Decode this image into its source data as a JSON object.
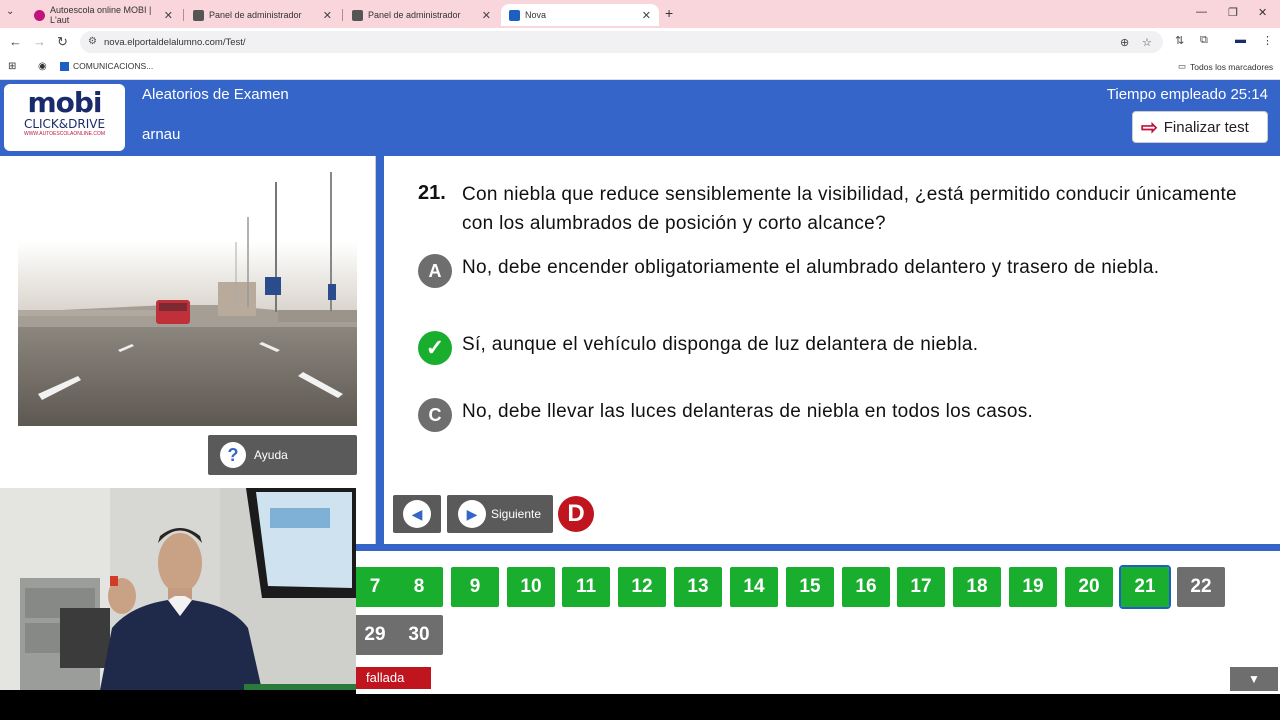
{
  "browser": {
    "tabs": [
      {
        "title": "Autoescola online MOBI | L'aut",
        "color": "#c0147a"
      },
      {
        "title": "Panel de administrador",
        "color": "#444"
      },
      {
        "title": "Panel de administrador",
        "color": "#444"
      },
      {
        "title": "Nova",
        "color": "#1e5fc4"
      }
    ],
    "new_tab": "+",
    "url": "nova.elportaldelalumno.com/Test/",
    "bookmarks": [
      {
        "label": "COMUNICACIONS..."
      }
    ],
    "all_bookmarks": "Todos los marcadores"
  },
  "header": {
    "logo_main": "mobi",
    "logo_sub": "CLICK&DRIVE",
    "logo_url": "WWW.AUTOESCOLAONLINE.COM",
    "exam_title": "Aleatorios de Examen",
    "user": "arnau",
    "timer": "Tiempo empleado 25:14",
    "finish_label": "Finalizar test"
  },
  "left": {
    "help_label": "Ayuda"
  },
  "question": {
    "number": "21.",
    "text": "Con niebla que reduce sensiblemente la visibilidad, ¿está permitido conducir únicamente con los alumbrados de posición y corto alcance?",
    "answers": [
      {
        "letter": "A",
        "text": "No, debe encender obligatoriamente el alumbrado delantero y trasero de niebla.",
        "correct": false
      },
      {
        "letter": "✓",
        "text": "Sí, aunque el vehículo disponga de luz delantera de niebla.",
        "correct": true
      },
      {
        "letter": "C",
        "text": "No, debe llevar las luces delanteras de niebla en todos los casos.",
        "correct": false
      }
    ],
    "next_label": "Siguiente",
    "d_label": "D"
  },
  "grid": {
    "row1": [
      {
        "n": "7",
        "state": "answered"
      },
      {
        "n": "8",
        "state": "answered"
      },
      {
        "n": "9",
        "state": "answered"
      },
      {
        "n": "10",
        "state": "answered"
      },
      {
        "n": "11",
        "state": "answered"
      },
      {
        "n": "12",
        "state": "answered"
      },
      {
        "n": "13",
        "state": "answered"
      },
      {
        "n": "14",
        "state": "answered"
      },
      {
        "n": "15",
        "state": "answered"
      },
      {
        "n": "16",
        "state": "answered"
      },
      {
        "n": "17",
        "state": "answered"
      },
      {
        "n": "18",
        "state": "answered"
      },
      {
        "n": "19",
        "state": "answered"
      },
      {
        "n": "20",
        "state": "answered"
      },
      {
        "n": "21",
        "state": "current"
      },
      {
        "n": "22",
        "state": "pending"
      }
    ],
    "row2": [
      {
        "n": "29",
        "state": "pending"
      },
      {
        "n": "30",
        "state": "pending"
      }
    ],
    "legend_failed": "fallada",
    "scroll_icon": "▼"
  },
  "colors": {
    "brand_blue": "#3565c9",
    "green": "#1aae2e",
    "grey": "#6e6e6e",
    "red": "#c0141e"
  }
}
